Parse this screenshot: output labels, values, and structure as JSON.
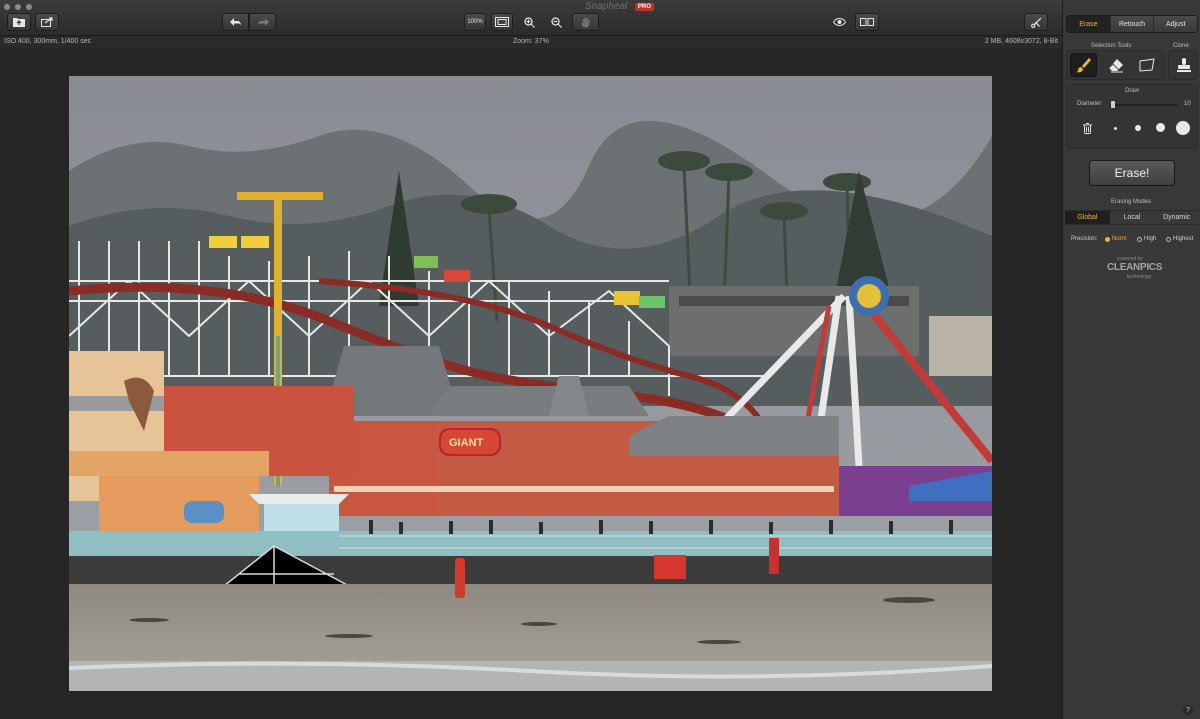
{
  "window": {
    "app_name": "Snapheal",
    "badge": "PRO"
  },
  "toolbar": {
    "open_icon": "folder-open-icon",
    "export_icon": "share-export-icon",
    "undo_icon": "undo-arrow-icon",
    "redo_icon": "redo-arrow-icon",
    "zoom_actual_label": "100%",
    "fit_icon": "fit-to-screen-icon",
    "zoom_in_icon": "zoom-in-icon",
    "zoom_out_icon": "zoom-out-icon",
    "hand_icon": "hand-pan-icon",
    "preview_icon": "eye-icon",
    "compare_icon": "compare-split-icon",
    "tools_icon": "scissors-icon"
  },
  "info_bar": {
    "exif": "ISO 400, 300mm, 1/400 sec",
    "zoom": "Zoom: 37%",
    "file_info": "2 MB, 4608x3072, 8-Bit"
  },
  "panel": {
    "tabs": [
      {
        "label": "Erase",
        "active": true
      },
      {
        "label": "Retouch",
        "active": false
      },
      {
        "label": "Adjust",
        "active": false
      }
    ],
    "selection_tools_label": "Selection Tools",
    "clone_label": "Clone",
    "selection_tools": [
      "brush-icon",
      "eraser-icon",
      "lasso-icon"
    ],
    "clone_tool": "stamp-icon",
    "draw_label": "Draw",
    "diameter_label": "Diameter",
    "diameter_value": "10",
    "diameter_fraction": 0.02,
    "brush_sizes_icon": "trash-can-icon",
    "erase_button": "Erase!",
    "erasing_modes_label": "Erasing Modes",
    "modes": [
      {
        "label": "Global",
        "active": true
      },
      {
        "label": "Local",
        "active": false
      },
      {
        "label": "Dynamic",
        "active": false
      }
    ],
    "precision_label": "Precision:",
    "precision_options": [
      {
        "label": "Norm",
        "selected": true
      },
      {
        "label": "High",
        "selected": false
      },
      {
        "label": "Highest",
        "selected": false
      }
    ],
    "powered_by": "powered by",
    "brand_main": "CLEANPICS",
    "brand_sub": "technology",
    "help": "?"
  },
  "colors": {
    "accent": "#f0b429",
    "panel_bg": "#383838",
    "canvas_bg": "#262626"
  }
}
